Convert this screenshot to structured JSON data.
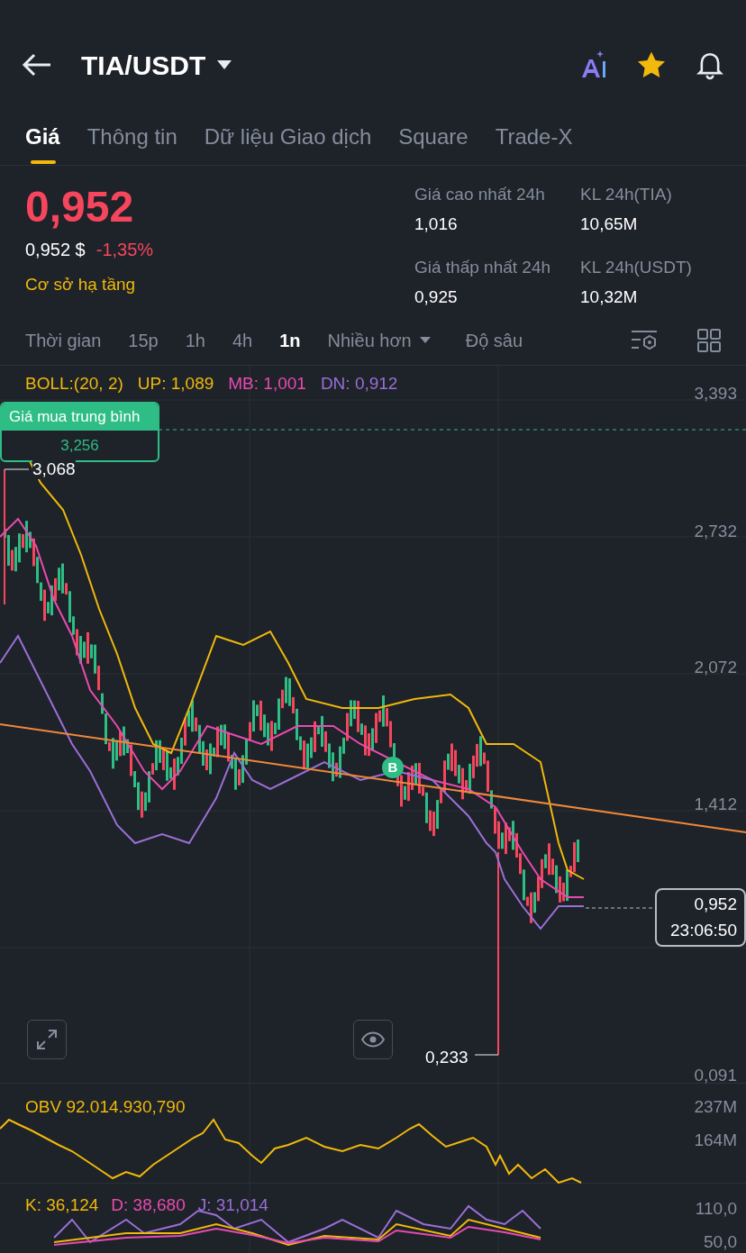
{
  "header": {
    "pair": "TIA/USDT"
  },
  "tabs": [
    {
      "label": "Giá",
      "selected": true
    },
    {
      "label": "Thông tin",
      "selected": false
    },
    {
      "label": "Dữ liệu Giao dịch",
      "selected": false
    },
    {
      "label": "Square",
      "selected": false
    },
    {
      "label": "Trade-X",
      "selected": false
    }
  ],
  "price": {
    "last": "0,952",
    "usd": "0,952 $",
    "change": "-1,35%",
    "tag": "Cơ sở hạ tầng"
  },
  "stats": [
    {
      "label": "Giá cao nhất 24h",
      "value": "1,016"
    },
    {
      "label": "KL 24h(TIA)",
      "value": "10,65M"
    },
    {
      "label": "Giá thấp nhất 24h",
      "value": "0,925"
    },
    {
      "label": "KL 24h(USDT)",
      "value": "10,32M"
    }
  ],
  "intervals": [
    {
      "label": "Thời gian",
      "selected": false,
      "kind": "plain"
    },
    {
      "label": "15p",
      "selected": false,
      "kind": "plain"
    },
    {
      "label": "1h",
      "selected": false,
      "kind": "plain"
    },
    {
      "label": "4h",
      "selected": false,
      "kind": "plain"
    },
    {
      "label": "1n",
      "selected": true,
      "kind": "plain"
    },
    {
      "label": "Nhiều hơn",
      "selected": false,
      "kind": "dropdown"
    },
    {
      "label": "Độ sâu",
      "selected": false,
      "kind": "plain"
    }
  ],
  "boll": [
    {
      "text": "BOLL:(20, 2)",
      "color": "#f0b90b"
    },
    {
      "text": "UP: 1,089",
      "color": "#f0b90b"
    },
    {
      "text": "MB: 1,001",
      "color": "#e84bb0"
    },
    {
      "text": "DN: 0,912",
      "color": "#9b6fd6"
    }
  ],
  "price_axis": [
    "3,393",
    "2,732",
    "2,072",
    "1,412",
    "0,091"
  ],
  "avg_buy": {
    "label": "Giá mua trung bình",
    "value": "3,256"
  },
  "high_mark": "3,068",
  "low_mark": "0,233",
  "marker": "B",
  "current": {
    "price": "0,952",
    "countdown": "23:06:50"
  },
  "obv": {
    "label": "OBV 92.014.930,790",
    "axis": [
      "237M",
      "164M"
    ]
  },
  "kdj": {
    "items": [
      {
        "text": "K: 36,124",
        "color": "#f0b90b"
      },
      {
        "text": "D: 38,680",
        "color": "#e84bb0"
      },
      {
        "text": "J: 31,014",
        "color": "#9b6fd6"
      }
    ],
    "axis": [
      "110,0",
      "50,0"
    ]
  }
}
